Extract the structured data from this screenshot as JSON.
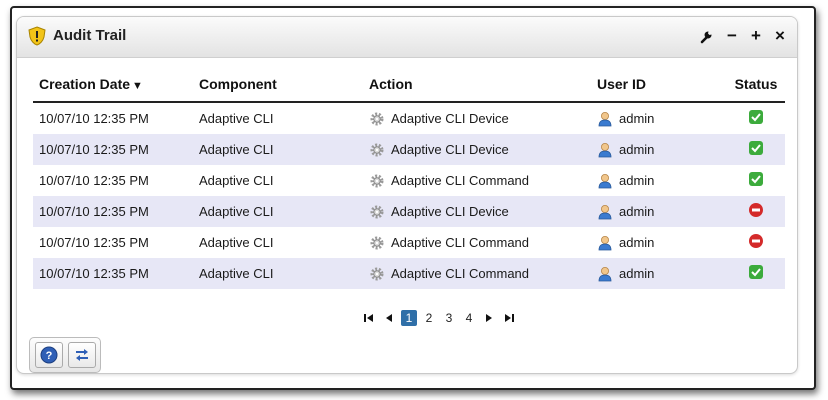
{
  "portlet": {
    "title": "Audit Trail",
    "actions": {
      "settings_icon": "wrench-icon",
      "minimize": "−",
      "maximize": "+",
      "close": "×"
    }
  },
  "table": {
    "columns": {
      "creation_date": "Creation Date",
      "component": "Component",
      "action": "Action",
      "user_id": "User ID",
      "status": "Status"
    },
    "sort_indicator": "▼",
    "rows": [
      {
        "date": "10/07/10 12:35 PM",
        "component": "Adaptive CLI",
        "action": "Adaptive CLI Device",
        "user": "admin",
        "status": "success"
      },
      {
        "date": "10/07/10 12:35 PM",
        "component": "Adaptive CLI",
        "action": "Adaptive CLI Device",
        "user": "admin",
        "status": "success"
      },
      {
        "date": "10/07/10 12:35 PM",
        "component": "Adaptive CLI",
        "action": "Adaptive CLI Command",
        "user": "admin",
        "status": "success"
      },
      {
        "date": "10/07/10 12:35 PM",
        "component": "Adaptive CLI",
        "action": "Adaptive CLI Device",
        "user": "admin",
        "status": "error"
      },
      {
        "date": "10/07/10 12:35 PM",
        "component": "Adaptive CLI",
        "action": "Adaptive CLI Command",
        "user": "admin",
        "status": "error"
      },
      {
        "date": "10/07/10 12:35 PM",
        "component": "Adaptive CLI",
        "action": "Adaptive CLI Command",
        "user": "admin",
        "status": "success"
      }
    ]
  },
  "pager": {
    "first": "⏮",
    "prev": "◀",
    "pages": [
      "1",
      "2",
      "3",
      "4"
    ],
    "current": "1",
    "next": "▶",
    "last": "⏭"
  },
  "colors": {
    "success": "#3cab3c",
    "error": "#d42a2a",
    "alt_row": "#e7e7f6",
    "active_page": "#2f6fa8"
  }
}
